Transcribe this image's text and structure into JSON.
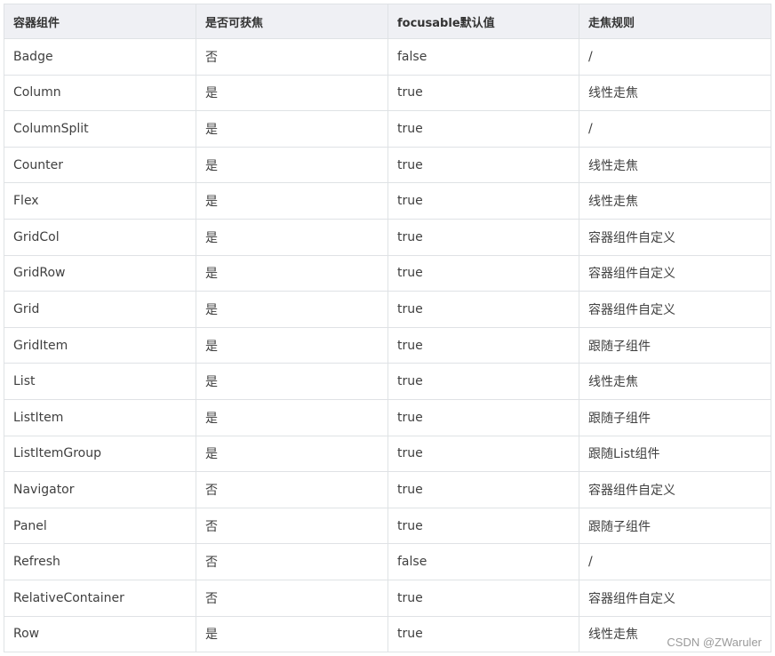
{
  "table": {
    "headers": [
      "容器组件",
      "是否可获焦",
      "focusable默认值",
      "走焦规则"
    ],
    "rows": [
      [
        "Badge",
        "否",
        "false",
        "/"
      ],
      [
        "Column",
        "是",
        "true",
        "线性走焦"
      ],
      [
        "ColumnSplit",
        "是",
        "true",
        "/"
      ],
      [
        "Counter",
        "是",
        "true",
        "线性走焦"
      ],
      [
        "Flex",
        "是",
        "true",
        "线性走焦"
      ],
      [
        "GridCol",
        "是",
        "true",
        "容器组件自定义"
      ],
      [
        "GridRow",
        "是",
        "true",
        "容器组件自定义"
      ],
      [
        "Grid",
        "是",
        "true",
        "容器组件自定义"
      ],
      [
        "GridItem",
        "是",
        "true",
        "跟随子组件"
      ],
      [
        "List",
        "是",
        "true",
        "线性走焦"
      ],
      [
        "ListItem",
        "是",
        "true",
        "跟随子组件"
      ],
      [
        "ListItemGroup",
        "是",
        "true",
        "跟随List组件"
      ],
      [
        "Navigator",
        "否",
        "true",
        "容器组件自定义"
      ],
      [
        "Panel",
        "否",
        "true",
        "跟随子组件"
      ],
      [
        "Refresh",
        "否",
        "false",
        "/"
      ],
      [
        "RelativeContainer",
        "否",
        "true",
        "容器组件自定义"
      ],
      [
        "Row",
        "是",
        "true",
        "线性走焦"
      ]
    ]
  },
  "watermark": "CSDN @ZWaruler",
  "colors": {
    "header_bg": "#eff0f4",
    "border": "#dfe2e5",
    "text": "#404040"
  }
}
